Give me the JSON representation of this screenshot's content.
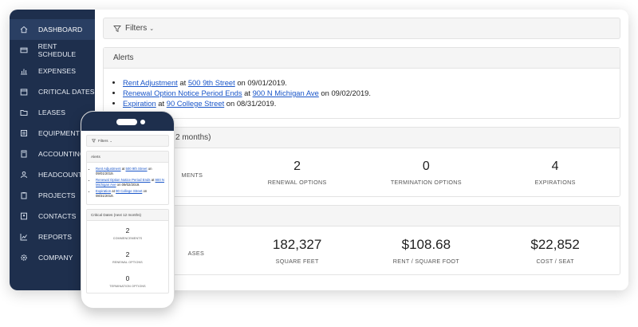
{
  "sidebar": {
    "items": [
      {
        "label": "DASHBOARD",
        "icon": "home-icon"
      },
      {
        "label": "RENT SCHEDULE",
        "icon": "card-icon"
      },
      {
        "label": "EXPENSES",
        "icon": "bar-chart-icon"
      },
      {
        "label": "CRITICAL DATES",
        "icon": "calendar-icon"
      },
      {
        "label": "LEASES",
        "icon": "folder-icon"
      },
      {
        "label": "EQUIPMENT",
        "icon": "monitor-icon"
      },
      {
        "label": "ACCOUNTING",
        "icon": "calculator-icon"
      },
      {
        "label": "HEADCOUNT",
        "icon": "user-icon"
      },
      {
        "label": "PROJECTS",
        "icon": "clipboard-icon"
      },
      {
        "label": "CONTACTS",
        "icon": "address-book-icon"
      },
      {
        "label": "REPORTS",
        "icon": "chart-icon"
      },
      {
        "label": "COMPANY",
        "icon": "gear-icon"
      }
    ]
  },
  "filters": {
    "label": "Filters"
  },
  "alerts": {
    "title": "Alerts",
    "items": [
      {
        "link": "Rent Adjustment",
        "mid": " at ",
        "link2": "500 9th Street",
        "tail": " on 09/01/2019."
      },
      {
        "link": "Renewal Option Notice Period Ends",
        "mid": " at ",
        "link2": "900 N Michigan Ave",
        "tail": " on 09/02/2019."
      },
      {
        "link": "Expiration",
        "mid": " at ",
        "link2": "90 College Street",
        "tail": " on 08/31/2019."
      }
    ]
  },
  "critical_dates": {
    "title_partial": "2 months)",
    "stats": [
      {
        "num": "",
        "label": "MENTS"
      },
      {
        "num": "2",
        "label": "RENEWAL OPTIONS"
      },
      {
        "num": "0",
        "label": "TERMINATION OPTIONS"
      },
      {
        "num": "4",
        "label": "EXPIRATIONS"
      }
    ]
  },
  "portfolio": {
    "stats": [
      {
        "num": "",
        "label": "ASES"
      },
      {
        "num": "182,327",
        "label": "SQUARE FEET"
      },
      {
        "num": "$108.68",
        "label": "RENT / SQUARE FOOT"
      },
      {
        "num": "$22,852",
        "label": "COST / SEAT"
      }
    ]
  },
  "phone": {
    "filters": "Filters",
    "alerts_title": "Alerts",
    "alerts": [
      {
        "link": "Rent Adjustment",
        "mid": " at ",
        "link2": "500 9th Street",
        "tail": " on 09/01/2019."
      },
      {
        "link": "Renewal Option Notice Period Ends",
        "mid": " at ",
        "link2": "900 N Michigan Ave",
        "tail": " on 09/02/2019."
      },
      {
        "link": "Expiration",
        "mid": " at ",
        "link2": "90 College Street",
        "tail": " on 08/31/2019."
      }
    ],
    "critical_title": "Critical Dates (next 12 months)",
    "stats": [
      {
        "num": "2",
        "label": "COMMENCEMENTS"
      },
      {
        "num": "2",
        "label": "RENEWAL OPTIONS"
      },
      {
        "num": "0",
        "label": "TERMINATION OPTIONS"
      }
    ]
  },
  "colors": {
    "sidebar": "#1e2f4d",
    "link": "#1a56c9"
  }
}
